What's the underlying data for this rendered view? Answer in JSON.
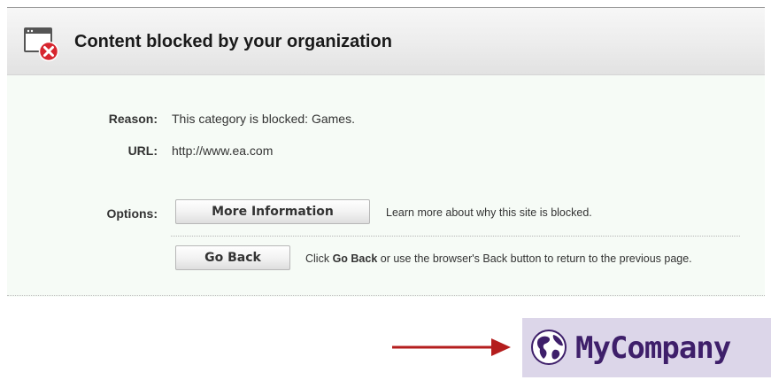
{
  "header": {
    "title": "Content blocked by your organization",
    "icon": "browser-window-blocked-icon"
  },
  "details": {
    "reason_label": "Reason:",
    "reason_value": "This category is blocked: Games.",
    "url_label": "URL:",
    "url_value": "http://www.ea.com"
  },
  "options": {
    "label": "Options:",
    "more_info_button": "More Information",
    "more_info_desc": "Learn more about why this site is blocked.",
    "go_back_button": "Go Back",
    "go_back_desc_prefix": "Click ",
    "go_back_desc_bold": "Go Back",
    "go_back_desc_suffix": " or use the browser's Back button to return to the previous page."
  },
  "annotation": {
    "arrow_icon": "right-arrow-icon",
    "arrow_color": "#b41d1d"
  },
  "logo": {
    "text": "MyCompany",
    "icon": "globe-icon",
    "background": "#dcd6e9",
    "color": "#3e1f6a"
  }
}
